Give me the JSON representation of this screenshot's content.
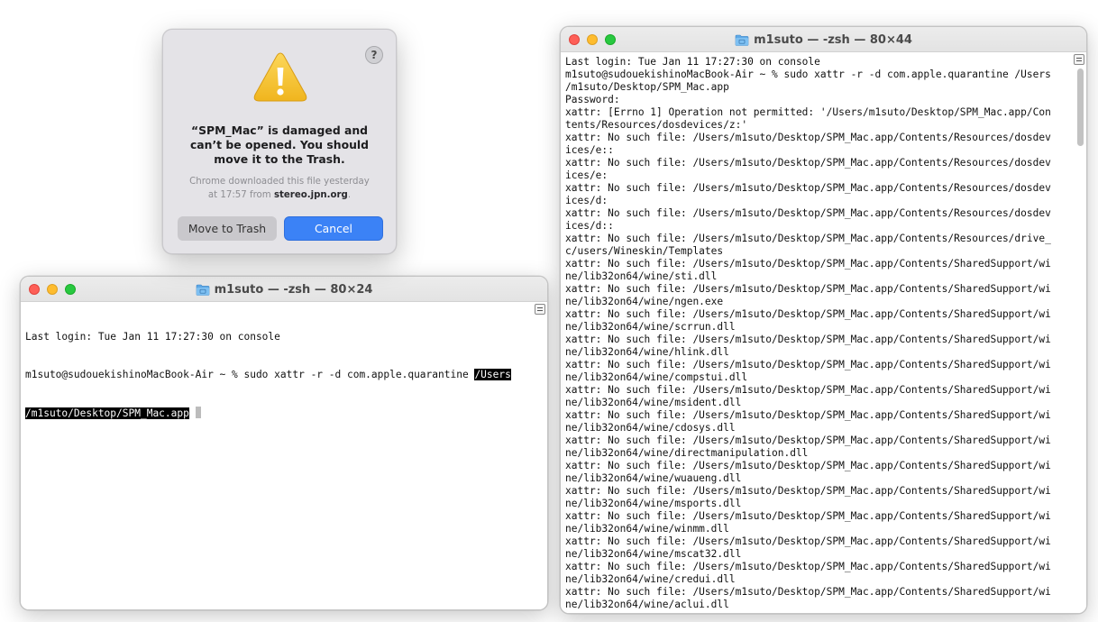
{
  "alert": {
    "help_label": "?",
    "title_lines": [
      "“SPM_Mac” is damaged and",
      "can’t be opened. You should",
      "move it to the Trash."
    ],
    "info_line1": "Chrome downloaded this file yesterday",
    "info_line2_prefix": "at 17:57 from ",
    "info_source": "stereo.jpn.org",
    "info_suffix": ".",
    "move_to_trash_label": "Move to Trash",
    "cancel_label": "Cancel",
    "warning_color": "#f7c22e",
    "accent_color": "#3b82f6"
  },
  "terminal_small": {
    "title": "m1suto — -zsh — 80×24",
    "line1": "Last login: Tue Jan 11 17:27:30 on console",
    "prompt": "m1suto@sudouekishinoMacBook-Air ~ % sudo xattr -r -d com.apple.quarantine ",
    "sel1": "/Users",
    "sel2": "/m1suto/Desktop/SPM_Mac.app"
  },
  "terminal_large": {
    "title": "m1suto — -zsh — 80×44",
    "lines": [
      "Last login: Tue Jan 11 17:27:30 on console",
      "m1suto@sudouekishinoMacBook-Air ~ % sudo xattr -r -d com.apple.quarantine /Users",
      "/m1suto/Desktop/SPM_Mac.app",
      "Password:",
      "xattr: [Errno 1] Operation not permitted: '/Users/m1suto/Desktop/SPM_Mac.app/Con",
      "tents/Resources/dosdevices/z:'",
      "xattr: No such file: /Users/m1suto/Desktop/SPM_Mac.app/Contents/Resources/dosdev",
      "ices/e::",
      "xattr: No such file: /Users/m1suto/Desktop/SPM_Mac.app/Contents/Resources/dosdev",
      "ices/e:",
      "xattr: No such file: /Users/m1suto/Desktop/SPM_Mac.app/Contents/Resources/dosdev",
      "ices/d:",
      "xattr: No such file: /Users/m1suto/Desktop/SPM_Mac.app/Contents/Resources/dosdev",
      "ices/d::",
      "xattr: No such file: /Users/m1suto/Desktop/SPM_Mac.app/Contents/Resources/drive_",
      "c/users/Wineskin/Templates",
      "xattr: No such file: /Users/m1suto/Desktop/SPM_Mac.app/Contents/SharedSupport/wi",
      "ne/lib32on64/wine/sti.dll",
      "xattr: No such file: /Users/m1suto/Desktop/SPM_Mac.app/Contents/SharedSupport/wi",
      "ne/lib32on64/wine/ngen.exe",
      "xattr: No such file: /Users/m1suto/Desktop/SPM_Mac.app/Contents/SharedSupport/wi",
      "ne/lib32on64/wine/scrrun.dll",
      "xattr: No such file: /Users/m1suto/Desktop/SPM_Mac.app/Contents/SharedSupport/wi",
      "ne/lib32on64/wine/hlink.dll",
      "xattr: No such file: /Users/m1suto/Desktop/SPM_Mac.app/Contents/SharedSupport/wi",
      "ne/lib32on64/wine/compstui.dll",
      "xattr: No such file: /Users/m1suto/Desktop/SPM_Mac.app/Contents/SharedSupport/wi",
      "ne/lib32on64/wine/msident.dll",
      "xattr: No such file: /Users/m1suto/Desktop/SPM_Mac.app/Contents/SharedSupport/wi",
      "ne/lib32on64/wine/cdosys.dll",
      "xattr: No such file: /Users/m1suto/Desktop/SPM_Mac.app/Contents/SharedSupport/wi",
      "ne/lib32on64/wine/directmanipulation.dll",
      "xattr: No such file: /Users/m1suto/Desktop/SPM_Mac.app/Contents/SharedSupport/wi",
      "ne/lib32on64/wine/wuaueng.dll",
      "xattr: No such file: /Users/m1suto/Desktop/SPM_Mac.app/Contents/SharedSupport/wi",
      "ne/lib32on64/wine/msports.dll",
      "xattr: No such file: /Users/m1suto/Desktop/SPM_Mac.app/Contents/SharedSupport/wi",
      "ne/lib32on64/wine/winmm.dll",
      "xattr: No such file: /Users/m1suto/Desktop/SPM_Mac.app/Contents/SharedSupport/wi",
      "ne/lib32on64/wine/mscat32.dll",
      "xattr: No such file: /Users/m1suto/Desktop/SPM_Mac.app/Contents/SharedSupport/wi",
      "ne/lib32on64/wine/credui.dll",
      "xattr: No such file: /Users/m1suto/Desktop/SPM_Mac.app/Contents/SharedSupport/wi",
      "ne/lib32on64/wine/aclui.dll"
    ]
  }
}
